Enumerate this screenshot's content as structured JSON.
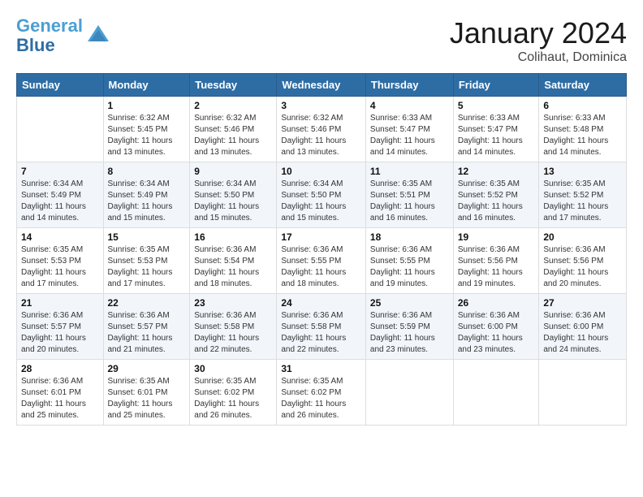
{
  "header": {
    "logo_line1": "General",
    "logo_line2": "Blue",
    "title": "January 2024",
    "subtitle": "Colihaut, Dominica"
  },
  "days_of_week": [
    "Sunday",
    "Monday",
    "Tuesday",
    "Wednesday",
    "Thursday",
    "Friday",
    "Saturday"
  ],
  "weeks": [
    [
      {
        "day": "",
        "info": ""
      },
      {
        "day": "1",
        "info": "Sunrise: 6:32 AM\nSunset: 5:45 PM\nDaylight: 11 hours\nand 13 minutes."
      },
      {
        "day": "2",
        "info": "Sunrise: 6:32 AM\nSunset: 5:46 PM\nDaylight: 11 hours\nand 13 minutes."
      },
      {
        "day": "3",
        "info": "Sunrise: 6:32 AM\nSunset: 5:46 PM\nDaylight: 11 hours\nand 13 minutes."
      },
      {
        "day": "4",
        "info": "Sunrise: 6:33 AM\nSunset: 5:47 PM\nDaylight: 11 hours\nand 14 minutes."
      },
      {
        "day": "5",
        "info": "Sunrise: 6:33 AM\nSunset: 5:47 PM\nDaylight: 11 hours\nand 14 minutes."
      },
      {
        "day": "6",
        "info": "Sunrise: 6:33 AM\nSunset: 5:48 PM\nDaylight: 11 hours\nand 14 minutes."
      }
    ],
    [
      {
        "day": "7",
        "info": "Sunrise: 6:34 AM\nSunset: 5:49 PM\nDaylight: 11 hours\nand 14 minutes."
      },
      {
        "day": "8",
        "info": "Sunrise: 6:34 AM\nSunset: 5:49 PM\nDaylight: 11 hours\nand 15 minutes."
      },
      {
        "day": "9",
        "info": "Sunrise: 6:34 AM\nSunset: 5:50 PM\nDaylight: 11 hours\nand 15 minutes."
      },
      {
        "day": "10",
        "info": "Sunrise: 6:34 AM\nSunset: 5:50 PM\nDaylight: 11 hours\nand 15 minutes."
      },
      {
        "day": "11",
        "info": "Sunrise: 6:35 AM\nSunset: 5:51 PM\nDaylight: 11 hours\nand 16 minutes."
      },
      {
        "day": "12",
        "info": "Sunrise: 6:35 AM\nSunset: 5:52 PM\nDaylight: 11 hours\nand 16 minutes."
      },
      {
        "day": "13",
        "info": "Sunrise: 6:35 AM\nSunset: 5:52 PM\nDaylight: 11 hours\nand 17 minutes."
      }
    ],
    [
      {
        "day": "14",
        "info": "Sunrise: 6:35 AM\nSunset: 5:53 PM\nDaylight: 11 hours\nand 17 minutes."
      },
      {
        "day": "15",
        "info": "Sunrise: 6:35 AM\nSunset: 5:53 PM\nDaylight: 11 hours\nand 17 minutes."
      },
      {
        "day": "16",
        "info": "Sunrise: 6:36 AM\nSunset: 5:54 PM\nDaylight: 11 hours\nand 18 minutes."
      },
      {
        "day": "17",
        "info": "Sunrise: 6:36 AM\nSunset: 5:55 PM\nDaylight: 11 hours\nand 18 minutes."
      },
      {
        "day": "18",
        "info": "Sunrise: 6:36 AM\nSunset: 5:55 PM\nDaylight: 11 hours\nand 19 minutes."
      },
      {
        "day": "19",
        "info": "Sunrise: 6:36 AM\nSunset: 5:56 PM\nDaylight: 11 hours\nand 19 minutes."
      },
      {
        "day": "20",
        "info": "Sunrise: 6:36 AM\nSunset: 5:56 PM\nDaylight: 11 hours\nand 20 minutes."
      }
    ],
    [
      {
        "day": "21",
        "info": "Sunrise: 6:36 AM\nSunset: 5:57 PM\nDaylight: 11 hours\nand 20 minutes."
      },
      {
        "day": "22",
        "info": "Sunrise: 6:36 AM\nSunset: 5:57 PM\nDaylight: 11 hours\nand 21 minutes."
      },
      {
        "day": "23",
        "info": "Sunrise: 6:36 AM\nSunset: 5:58 PM\nDaylight: 11 hours\nand 22 minutes."
      },
      {
        "day": "24",
        "info": "Sunrise: 6:36 AM\nSunset: 5:58 PM\nDaylight: 11 hours\nand 22 minutes."
      },
      {
        "day": "25",
        "info": "Sunrise: 6:36 AM\nSunset: 5:59 PM\nDaylight: 11 hours\nand 23 minutes."
      },
      {
        "day": "26",
        "info": "Sunrise: 6:36 AM\nSunset: 6:00 PM\nDaylight: 11 hours\nand 23 minutes."
      },
      {
        "day": "27",
        "info": "Sunrise: 6:36 AM\nSunset: 6:00 PM\nDaylight: 11 hours\nand 24 minutes."
      }
    ],
    [
      {
        "day": "28",
        "info": "Sunrise: 6:36 AM\nSunset: 6:01 PM\nDaylight: 11 hours\nand 25 minutes."
      },
      {
        "day": "29",
        "info": "Sunrise: 6:35 AM\nSunset: 6:01 PM\nDaylight: 11 hours\nand 25 minutes."
      },
      {
        "day": "30",
        "info": "Sunrise: 6:35 AM\nSunset: 6:02 PM\nDaylight: 11 hours\nand 26 minutes."
      },
      {
        "day": "31",
        "info": "Sunrise: 6:35 AM\nSunset: 6:02 PM\nDaylight: 11 hours\nand 26 minutes."
      },
      {
        "day": "",
        "info": ""
      },
      {
        "day": "",
        "info": ""
      },
      {
        "day": "",
        "info": ""
      }
    ]
  ]
}
